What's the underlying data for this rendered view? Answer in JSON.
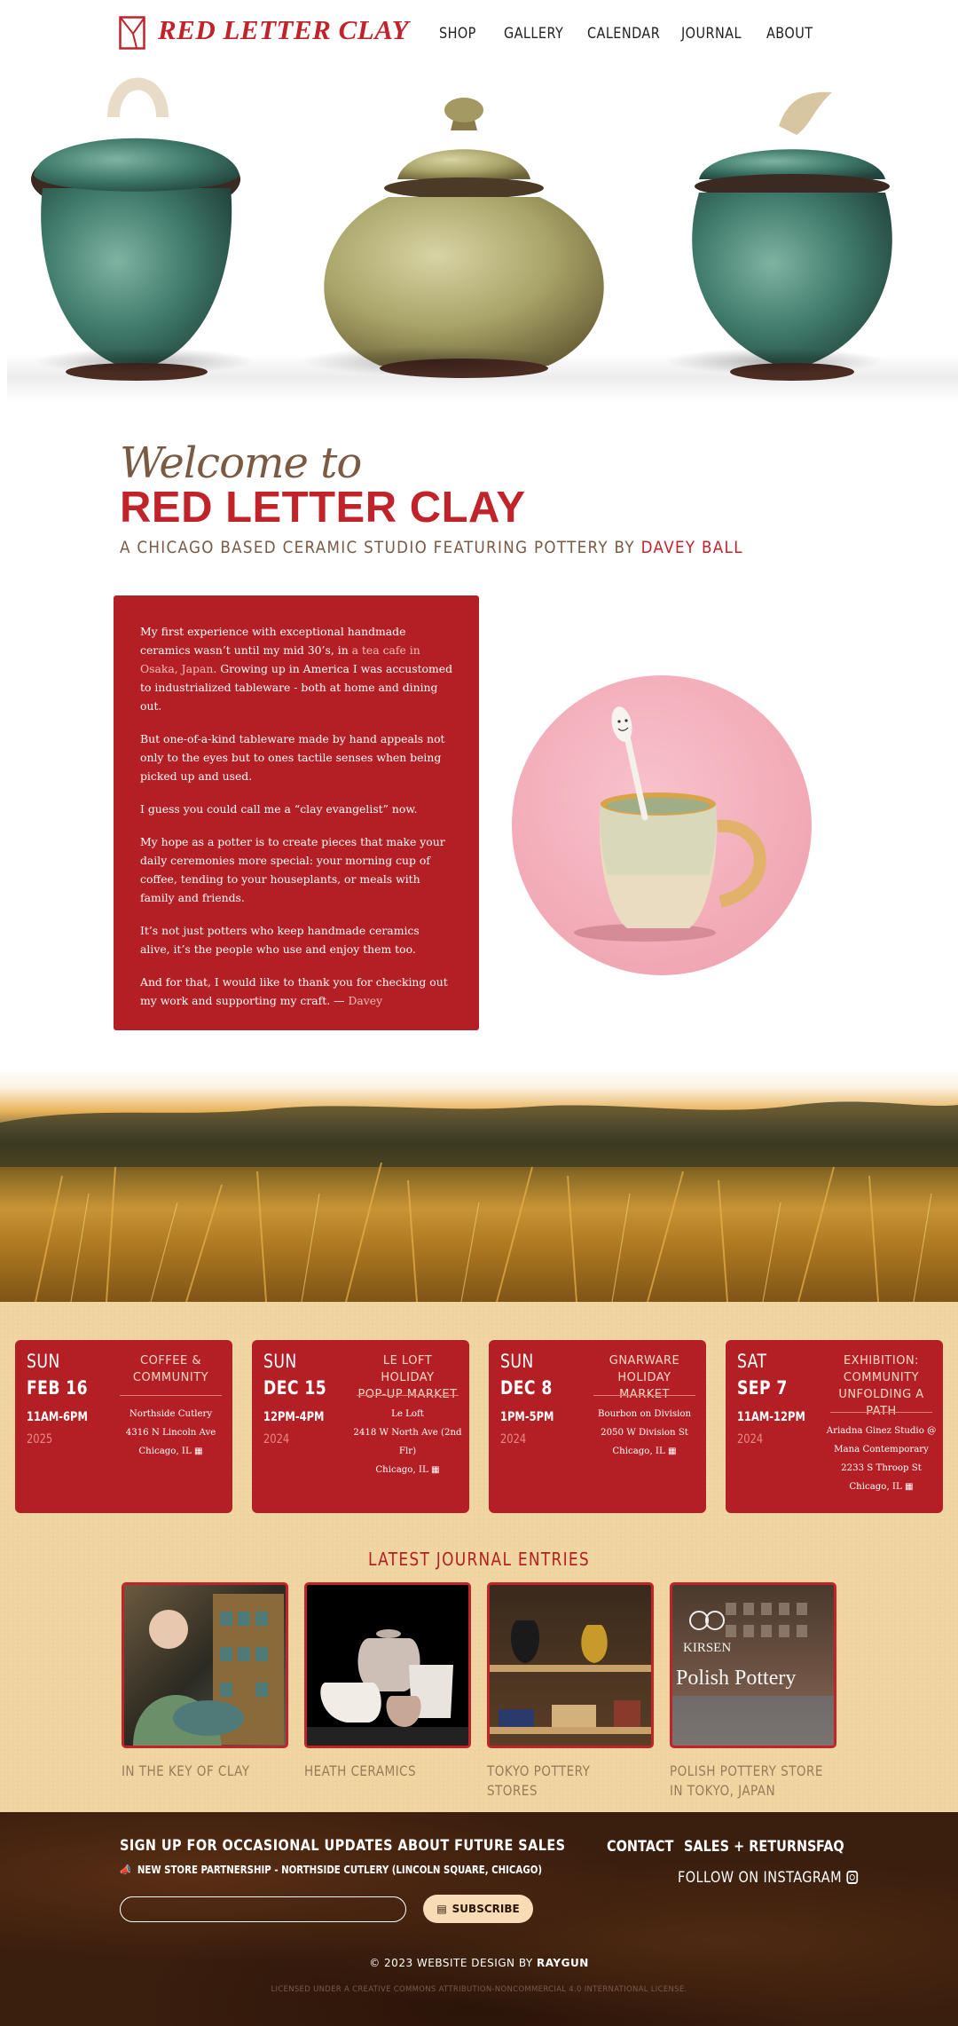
{
  "brand": {
    "name": "RED LETTER CLAY"
  },
  "nav": [
    "SHOP",
    "GALLERY",
    "CALENDAR",
    "JOURNAL",
    "ABOUT"
  ],
  "welcome": {
    "script": "Welcome to",
    "title": "RED LETTER CLAY",
    "subtitle_prefix": "A CHICAGO BASED CERAMIC STUDIO FEATURING POTTERY BY ",
    "subtitle_name": "DAVEY BALL"
  },
  "intro": {
    "p1_a": "My first experience with exceptional handmade ceramics wasn’t until my mid 30’s, in ",
    "p1_link": "a tea cafe in Osaka, Japan",
    "p1_b": ". Growing up in America I was accustomed to industrialized tableware - both at home and dining out.",
    "p2": "But one-of-a-kind tableware made by hand appeals not only to the eyes but to ones tactile senses when being picked up and used.",
    "p3": "I guess you could call me a “clay evangelist” now.",
    "p4": "My hope as a potter is to create pieces that make your daily ceremonies more special: your morning cup of coffee, tending to your houseplants, or meals with family and friends.",
    "p5": "It’s not just potters who keep handmade ceramics alive, it’s the people who use and enjoy them too.",
    "p6_a": "And for that, I would like to thank you for checking out my work and supporting my craft. — ",
    "p6_sig": "Davey"
  },
  "events": [
    {
      "dow": "SUN",
      "date": "FEB 16",
      "time": "11AM-6PM",
      "year": "2025",
      "title": [
        "COFFEE &",
        "COMMUNITY"
      ],
      "venue": [
        "Northside Cutlery",
        "4316 N Lincoln Ave",
        "Chicago, IL"
      ]
    },
    {
      "dow": "SUN",
      "date": "DEC 15",
      "time": "12PM-4PM",
      "year": "2024",
      "title": [
        "LE LOFT HOLIDAY",
        "POP-UP MARKET"
      ],
      "venue": [
        "Le Loft",
        "2418 W North Ave (2nd",
        "Flr)",
        "Chicago, IL"
      ]
    },
    {
      "dow": "SUN",
      "date": "DEC 8",
      "time": "1PM-5PM",
      "year": "2024",
      "title": [
        "GNARWARE",
        "HOLIDAY MARKET"
      ],
      "venue": [
        "Bourbon on Division",
        "2050 W Division St",
        "Chicago, IL"
      ]
    },
    {
      "dow": "SAT",
      "date": "SEP 7",
      "time": "11AM-12PM",
      "year": "2024",
      "title": [
        "EXHIBITION:",
        "COMMUNITY",
        "UNFOLDING A PATH"
      ],
      "venue": [
        "Ariadna Ginez Studio @",
        "Mana Contemporary",
        "2233 S Throop St",
        "Chicago, IL"
      ]
    }
  ],
  "journal": {
    "heading": "LATEST JOURNAL ENTRIES",
    "entries": [
      {
        "caption": "IN THE KEY OF CLAY"
      },
      {
        "caption": "HEATH CERAMICS"
      },
      {
        "caption": "TOKYO POTTERY STORES"
      },
      {
        "caption": "POLISH POTTERY STORE IN TOKYO, JAPAN",
        "sign_text": "Polish Pottery",
        "sign_small": "KIRSEN"
      }
    ]
  },
  "footer": {
    "signup": "SIGN UP FOR OCCASIONAL UPDATES ABOUT FUTURE SALES",
    "announcement": "NEW STORE PARTNERSHIP - NORTHSIDE CUTLERY (LINCOLN SQUARE, CHICAGO)",
    "input_value": "",
    "subscribe": "SUBSCRIBE",
    "links": [
      "CONTACT",
      "SALES + RETURNS",
      "FAQ"
    ],
    "instagram": "FOLLOW ON INSTAGRAM",
    "copyright_prefix": "© 2023 WEBSITE DESIGN BY ",
    "copyright_name": "RAYGUN",
    "license": "LICENSED UNDER A CREATIVE COMMONS ATTRIBUTION-NONCOMMERCIAL 4.0 INTERNATIONAL LICENSE."
  },
  "colors": {
    "brand_red": "#c0242a",
    "box_red": "#b41f25",
    "band_tan": "#efd4a0",
    "footer_brown": "#3a1e0e"
  },
  "icons": [
    "logo-mark-icon",
    "map-icon",
    "megaphone-icon",
    "inbox-icon",
    "instagram-icon"
  ]
}
